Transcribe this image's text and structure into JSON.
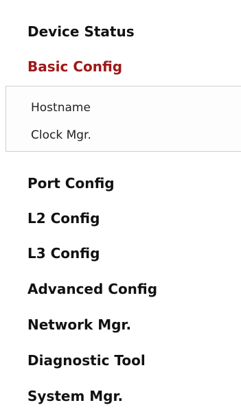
{
  "menu": {
    "device_status": "Device Status",
    "basic_config": "Basic Config",
    "basic_config_sub": {
      "hostname": "Hostname",
      "clock_mgr": "Clock Mgr."
    },
    "port_config": "Port Config",
    "l2_config": "L2 Config",
    "l3_config": "L3 Config",
    "advanced_config": "Advanced Config",
    "network_mgr": "Network Mgr.",
    "diagnostic_tool": "Diagnostic Tool",
    "system_mgr": "System Mgr."
  },
  "colors": {
    "active": "#a01818",
    "text": "#111111",
    "submenu_border": "#cfcfcf"
  }
}
